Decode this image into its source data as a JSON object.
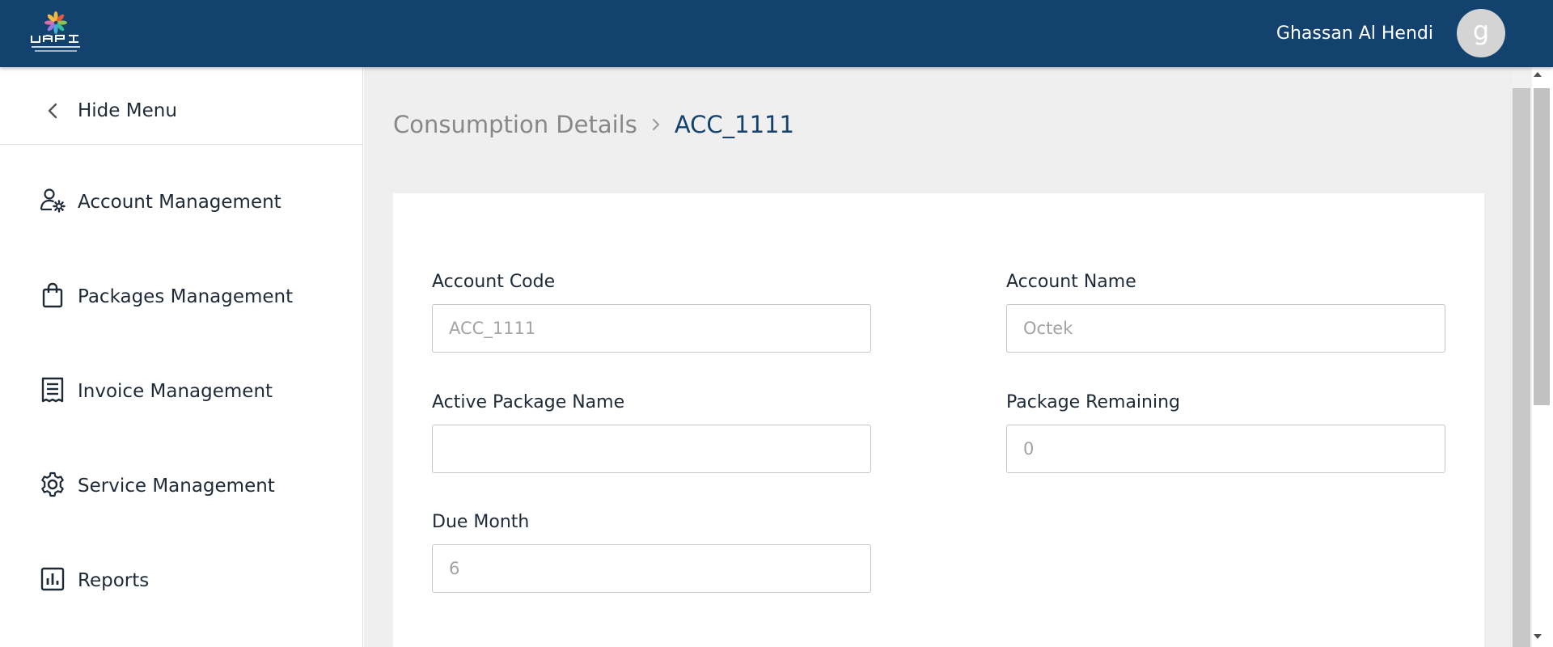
{
  "header": {
    "logo_icon": "uapi-logo",
    "user_name": "Ghassan Al Hendi",
    "avatar_initial": "g",
    "colors": {
      "header_bg": "#13426f",
      "avatar_bg": "#d4d4d4"
    }
  },
  "sidebar": {
    "hide_menu_label": "Hide Menu",
    "items": [
      {
        "label": "Account Management",
        "icon": "user-gear-icon"
      },
      {
        "label": "Packages Management",
        "icon": "shopping-bag-icon"
      },
      {
        "label": "Invoice Management",
        "icon": "receipt-icon"
      },
      {
        "label": "Service Management",
        "icon": "gear-icon"
      },
      {
        "label": "Reports",
        "icon": "bar-chart-icon"
      }
    ]
  },
  "main": {
    "breadcrumb": {
      "root": "Consumption Details",
      "current": "ACC_1111"
    },
    "form": {
      "account_code": {
        "label": "Account Code",
        "value": "ACC_1111"
      },
      "account_name": {
        "label": "Account Name",
        "value": "Octek"
      },
      "active_package_name": {
        "label": "Active Package Name",
        "value": ""
      },
      "package_remaining": {
        "label": "Package Remaining",
        "value": "0"
      },
      "due_month": {
        "label": "Due Month",
        "value": "6"
      }
    }
  }
}
